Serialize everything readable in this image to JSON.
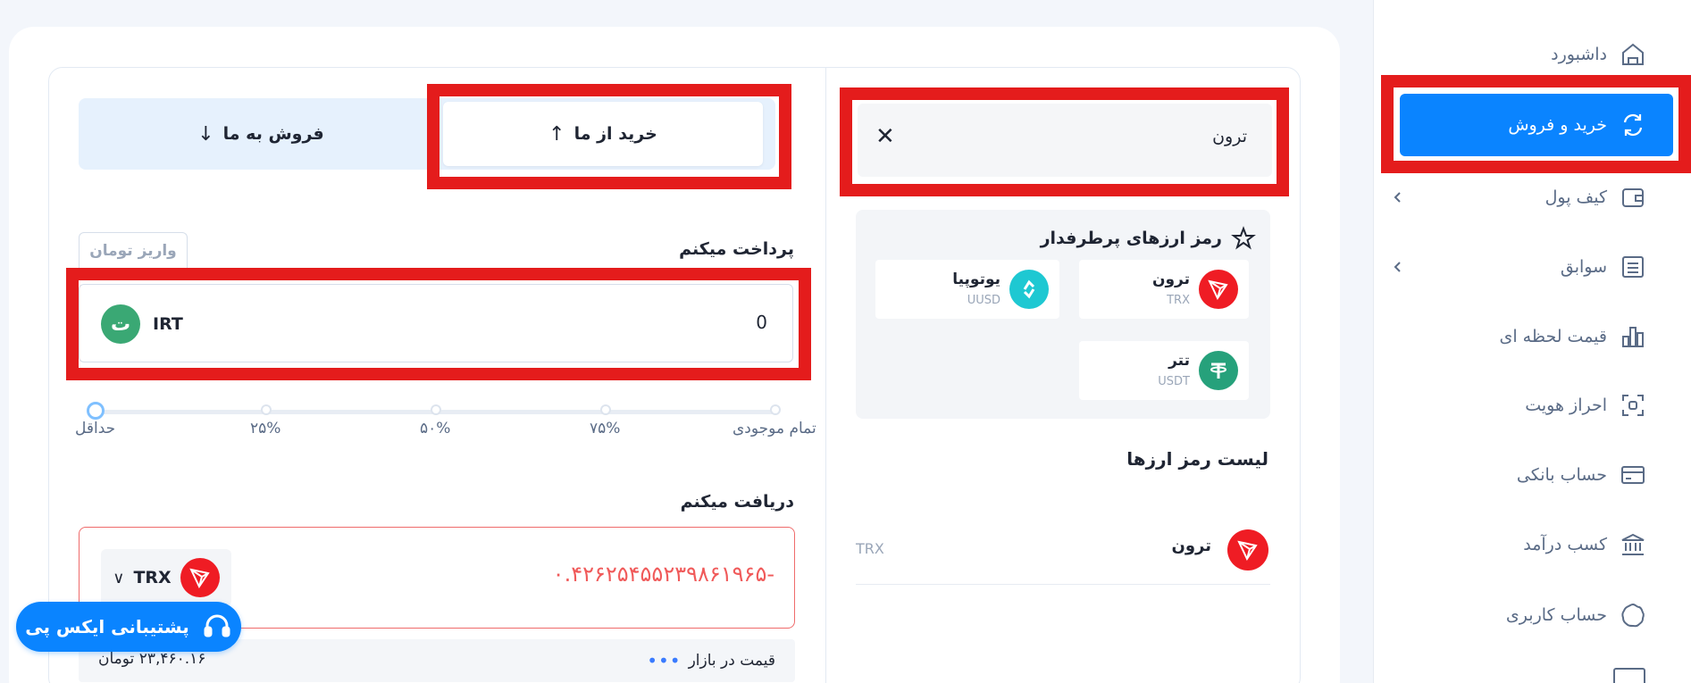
{
  "sidebar": {
    "items": [
      {
        "label": "داشبورد",
        "icon": "home-icon"
      },
      {
        "label": "خرید و فروش",
        "icon": "exchange-icon",
        "active": true
      },
      {
        "label": "کیف پول",
        "icon": "wallet-icon"
      },
      {
        "label": "سوابق",
        "icon": "list-icon"
      },
      {
        "label": "قیمت لحظه ای",
        "icon": "chart-icon"
      },
      {
        "label": "احراز هویت",
        "icon": "scan-icon"
      },
      {
        "label": "حساب بانکی",
        "icon": "card-icon"
      },
      {
        "label": "کسب درآمد",
        "icon": "bank-icon"
      },
      {
        "label": "حساب کاربری",
        "icon": "user-icon"
      }
    ]
  },
  "tabs": {
    "buy_label": "خرید از ما",
    "sell_label": "فروش به ما"
  },
  "pay": {
    "title": "پرداخت میکنم",
    "deposit_label": "واریز تومان",
    "amount": "0",
    "currency_code": "IRT",
    "currency_glyph": "ت"
  },
  "slider": {
    "labels": [
      "تمام موجودی",
      "۷۵%",
      "۵۰%",
      "۲۵%",
      "حداقل"
    ],
    "value_percent": 0
  },
  "receive": {
    "title": "دریافت میکنم",
    "amount": "۰.۴۲۶۲۵۴۵۵۲۳۹۸۶۱۹۶۵-",
    "currency_code": "TRX"
  },
  "market": {
    "label": "قیمت در بازار",
    "price": "۲۳,۴۶۰.۱۶ تومان"
  },
  "support": {
    "label": "پشتیبانی ایکس پی"
  },
  "search": {
    "value": "ترون"
  },
  "favorites": {
    "title": "رمز ارزهای پرطرفدار",
    "items": [
      {
        "name": "ترون",
        "symbol": "TRX",
        "color": "#ef1c24"
      },
      {
        "name": "یوتوپیا",
        "symbol": "UUSD",
        "color": "#1ec8d2"
      },
      {
        "name": "تتر",
        "symbol": "USDT",
        "color": "#26a17b"
      }
    ]
  },
  "crypto_list": {
    "title": "لیست رمز ارزها",
    "rows": [
      {
        "name": "ترون",
        "symbol": "TRX"
      }
    ]
  },
  "colors": {
    "accent": "#0a84ff",
    "highlight": "#e41c1c",
    "negative": "#f05a5a"
  }
}
